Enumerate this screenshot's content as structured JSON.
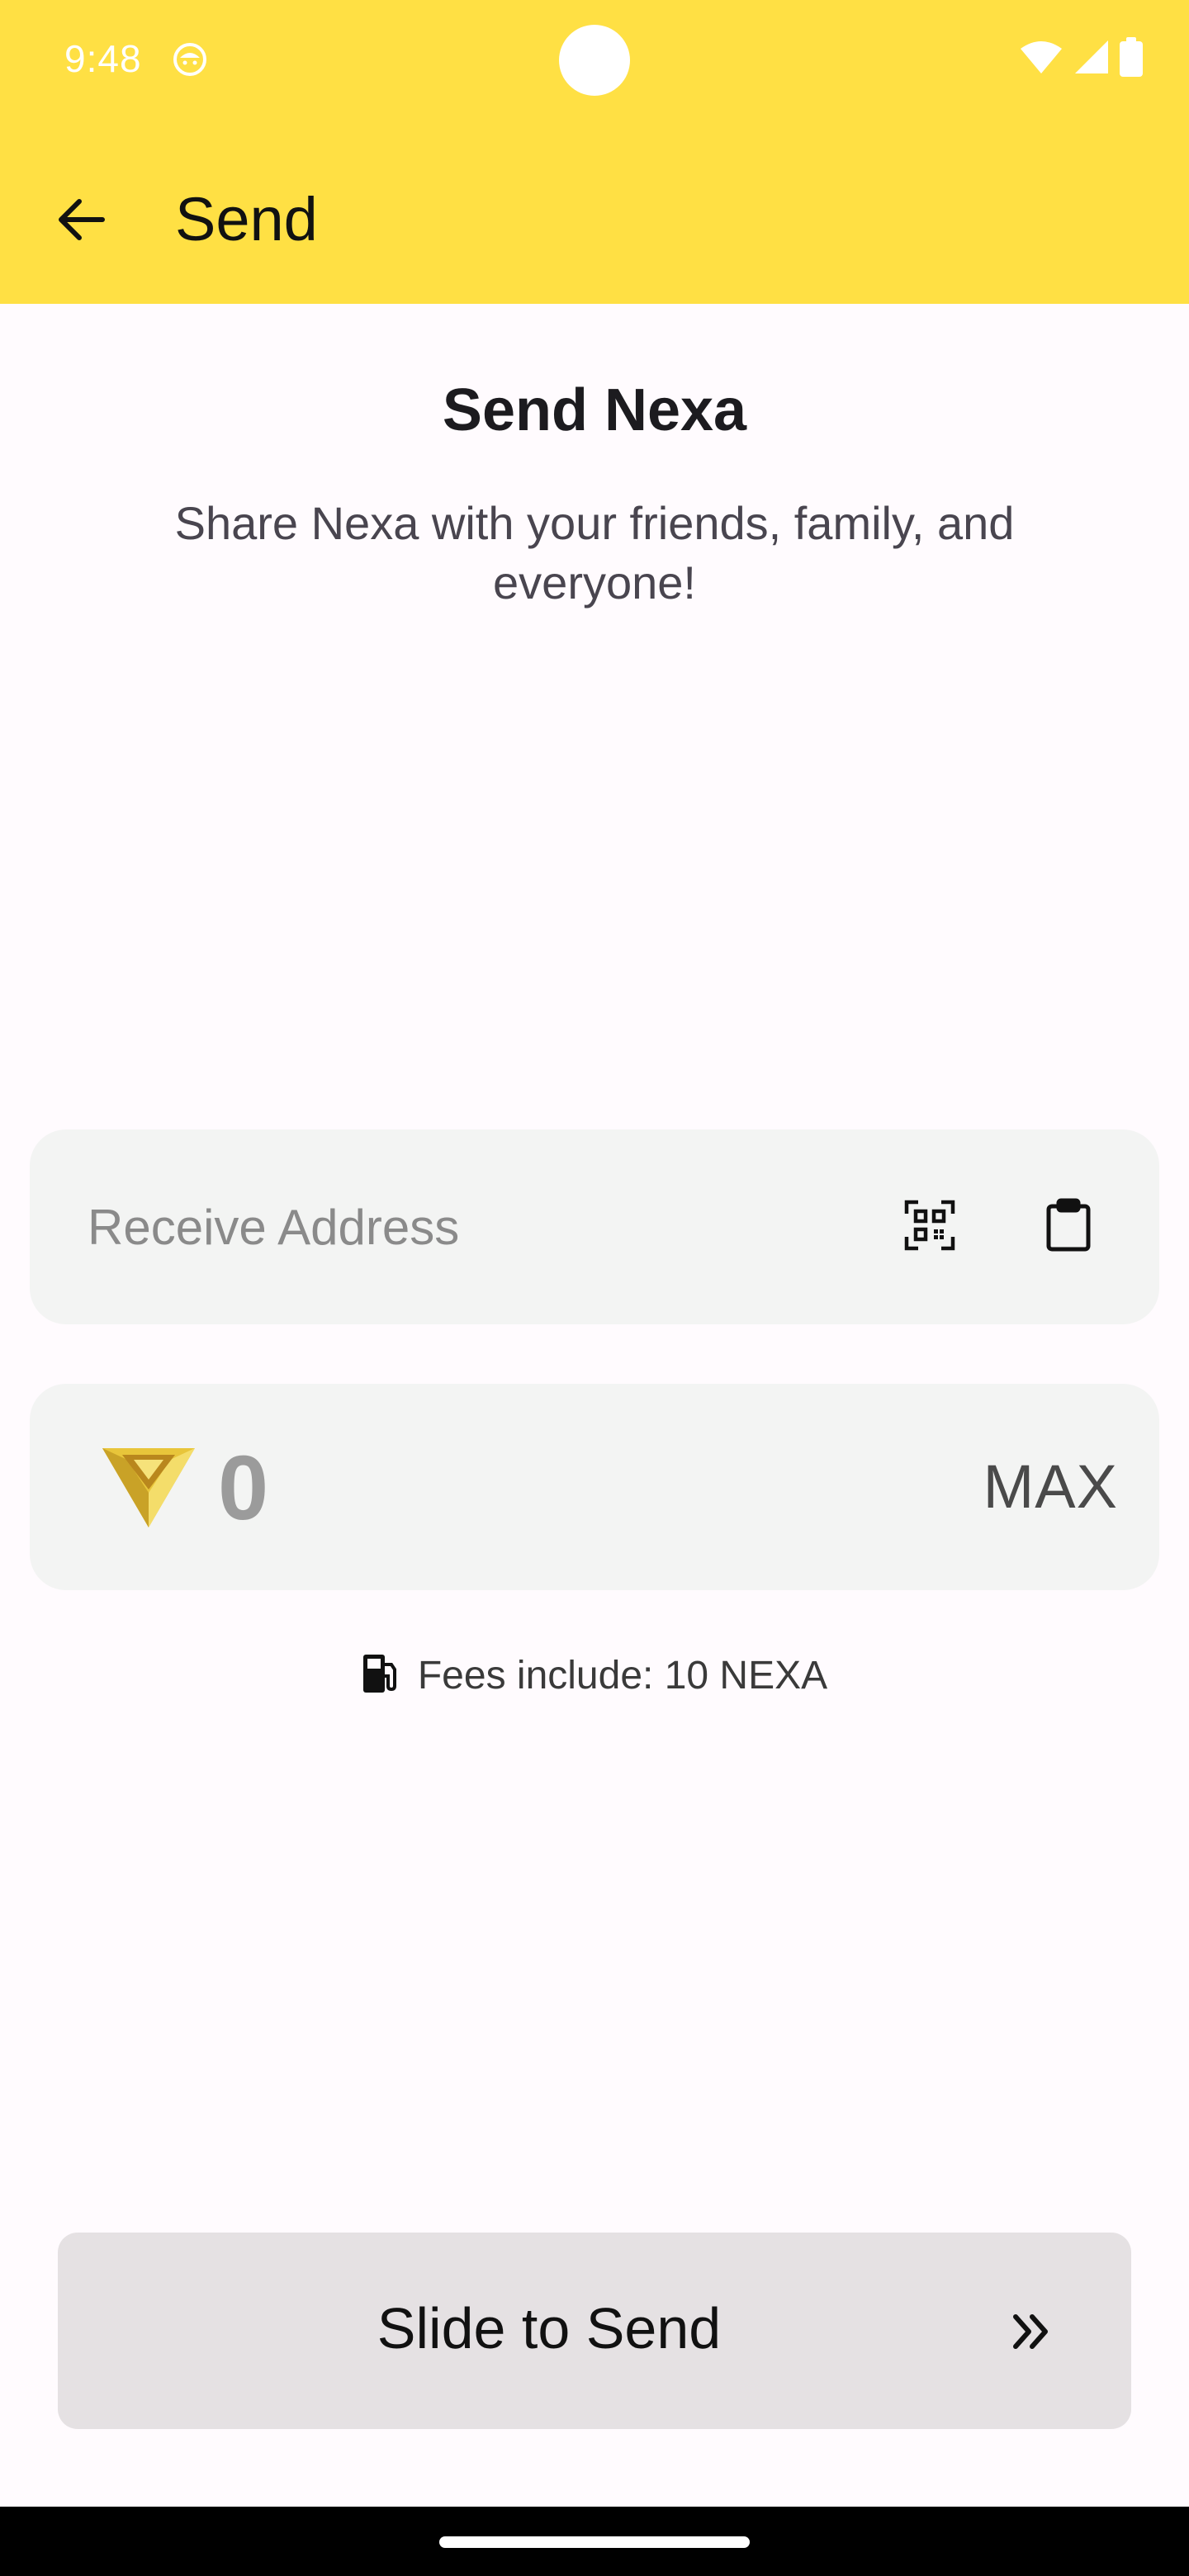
{
  "status_bar": {
    "time": "9:48",
    "icons": [
      "face-icon",
      "wifi-icon",
      "signal-icon",
      "battery-icon"
    ]
  },
  "app_bar": {
    "title": "Send",
    "back_icon": "arrow-left-icon"
  },
  "header": {
    "title": "Send Nexa",
    "subtitle": "Share Nexa with your friends, family, and everyone!"
  },
  "address": {
    "placeholder": "Receive Address",
    "value": "",
    "scan_icon": "qr-scan-icon",
    "paste_icon": "clipboard-icon"
  },
  "amount": {
    "placeholder": "0",
    "value": "",
    "max_label": "MAX",
    "currency_icon": "nexa-logo-icon"
  },
  "fees": {
    "icon": "fuel-pump-icon",
    "text": "Fees include: 10 NEXA"
  },
  "slide": {
    "label": "Slide to Send",
    "icon": "double-chevron-right-icon"
  },
  "colors": {
    "brand_yellow": "#FFE044",
    "card_bg": "#F3F4F3",
    "slide_bg": "#E5E1E3",
    "page_bg": "#FFFBFE"
  }
}
